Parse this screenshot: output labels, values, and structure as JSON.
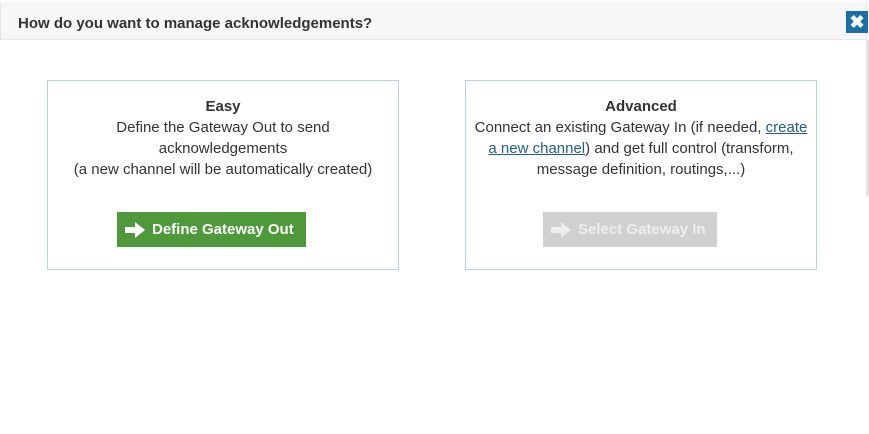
{
  "dialog": {
    "title": "How do you want to manage acknowledgements?",
    "close_icon": "close-icon"
  },
  "options": {
    "easy": {
      "title": "Easy",
      "desc_line1": "Define the Gateway Out to send acknowledgements",
      "desc_line2": "(a new channel will be automatically created)",
      "button_label": "Define Gateway Out",
      "button_color": "#4e9a3a",
      "button_icon": "arrow-right-icon"
    },
    "advanced": {
      "title": "Advanced",
      "desc_pre": "Connect an existing Gateway In (if needed, ",
      "link_text": "create a new channel",
      "desc_post": ") and get full control (transform, message definition, routings,...)",
      "button_label": "Select Gateway In",
      "button_disabled": true,
      "button_color": "#d0d0d0",
      "button_icon": "arrow-right-icon"
    }
  }
}
